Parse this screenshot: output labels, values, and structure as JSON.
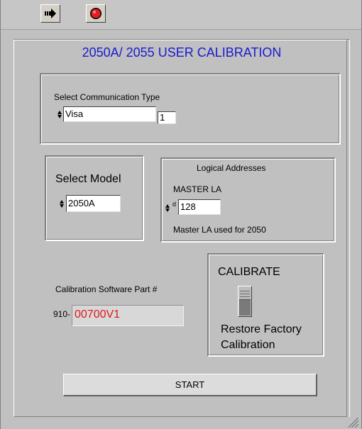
{
  "window": {
    "title": "2050A/ 2055 USER CALIBRATION"
  },
  "toolbar": {
    "run_icon": "run-arrow-icon",
    "stop_icon": "abort-stop-icon"
  },
  "comm": {
    "label": "Select Communication Type",
    "type_value": "Visa",
    "index_value": "1"
  },
  "model": {
    "label": "Select Model",
    "value": "2050A"
  },
  "logical": {
    "label": "Logical Addresses",
    "master_label": "MASTER LA",
    "radix": "d",
    "master_value": "128",
    "note": "Master LA used for 2050"
  },
  "part": {
    "label": "Calibration Software Part #",
    "prefix": "910-",
    "value": "00700V1"
  },
  "calibrate": {
    "title": "CALIBRATE",
    "restore_line1": "Restore Factory",
    "restore_line2": "Calibration"
  },
  "start": {
    "label": "START"
  },
  "colors": {
    "title_blue": "#1a1ad0",
    "readout_red": "#e01818",
    "panel_gray": "#c0c0c0"
  }
}
